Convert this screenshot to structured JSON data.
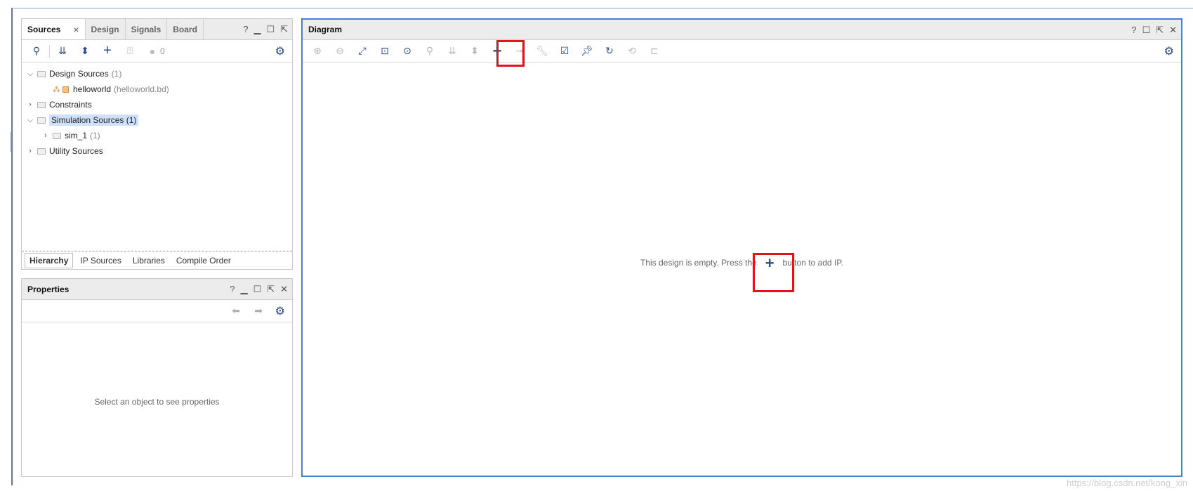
{
  "sources_panel": {
    "tabs": [
      {
        "label": "Sources",
        "close": "×"
      },
      {
        "label": "Design"
      },
      {
        "label": "Signals"
      },
      {
        "label": "Board"
      }
    ],
    "ctrl_help": "?",
    "toolbar_badge": "0",
    "tree": [
      {
        "label": "Design Sources",
        "count": "(1)"
      },
      {
        "label": "helloworld",
        "count": "(helloworld.bd)"
      },
      {
        "label": "Constraints"
      },
      {
        "label": "Simulation Sources (1)"
      },
      {
        "label": "sim_1",
        "count": "(1)"
      },
      {
        "label": "Utility Sources"
      }
    ],
    "bottom_tabs": [
      "Hierarchy",
      "IP Sources",
      "Libraries",
      "Compile Order"
    ]
  },
  "properties_panel": {
    "title": "Properties",
    "ctrl_help": "?",
    "empty_message": "Select an object to see properties"
  },
  "diagram_panel": {
    "title": "Diagram",
    "ctrl_help": "?",
    "message_before": "This design is empty. Press the",
    "message_after": "button to add IP.",
    "add_symbol": "+"
  },
  "watermark": "https://blog.csdn.net/kong_xin",
  "colors": {
    "selection": "#cfe0fa",
    "focus_border": "#4a7fd0",
    "highlight_box": "#e1141e",
    "icon_blue": "#2a4a8a"
  }
}
